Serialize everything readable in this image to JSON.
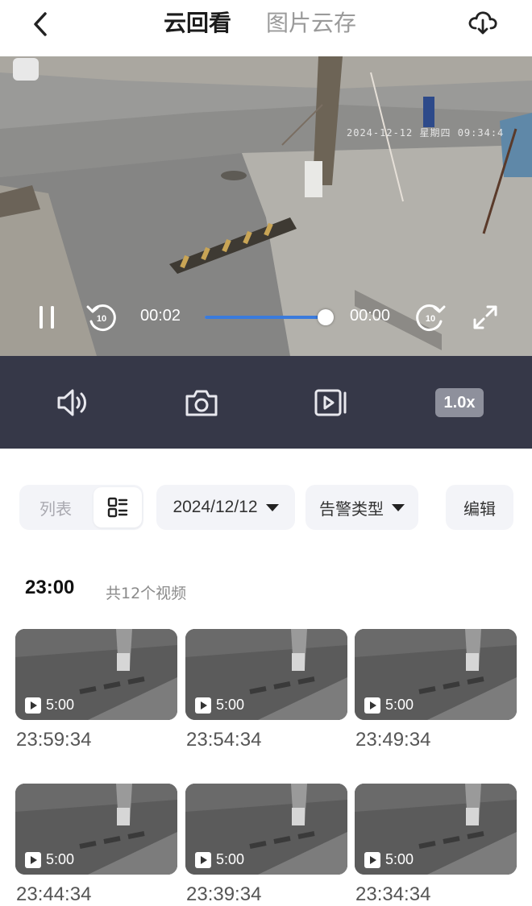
{
  "header": {
    "back_icon": "chevron-left-icon",
    "tab_active": "云回看",
    "tab_inactive": "图片云存",
    "download_icon": "cloud-download-icon"
  },
  "player": {
    "osd_timestamp": "2024-12-12  星期四  09:34:4",
    "current_time": "00:02",
    "total_time": "00:00",
    "progress": 0.99,
    "accent_color": "#3a7bdc"
  },
  "toolbar": {
    "speed_label": "1.0x",
    "icons": [
      "volume-icon",
      "camera-icon",
      "record-video-icon"
    ]
  },
  "filters": {
    "list_label": "列表",
    "date_value": "2024/12/12",
    "alarm_type_label": "告警类型",
    "edit_label": "编辑"
  },
  "section": {
    "hour": "23:00",
    "count_label": "共12个视频"
  },
  "clips": [
    {
      "duration": "5:00",
      "time": "23:59:34"
    },
    {
      "duration": "5:00",
      "time": "23:54:34"
    },
    {
      "duration": "5:00",
      "time": "23:49:34"
    },
    {
      "duration": "5:00",
      "time": "23:44:34"
    },
    {
      "duration": "5:00",
      "time": "23:39:34"
    },
    {
      "duration": "5:00",
      "time": "23:34:34"
    }
  ]
}
